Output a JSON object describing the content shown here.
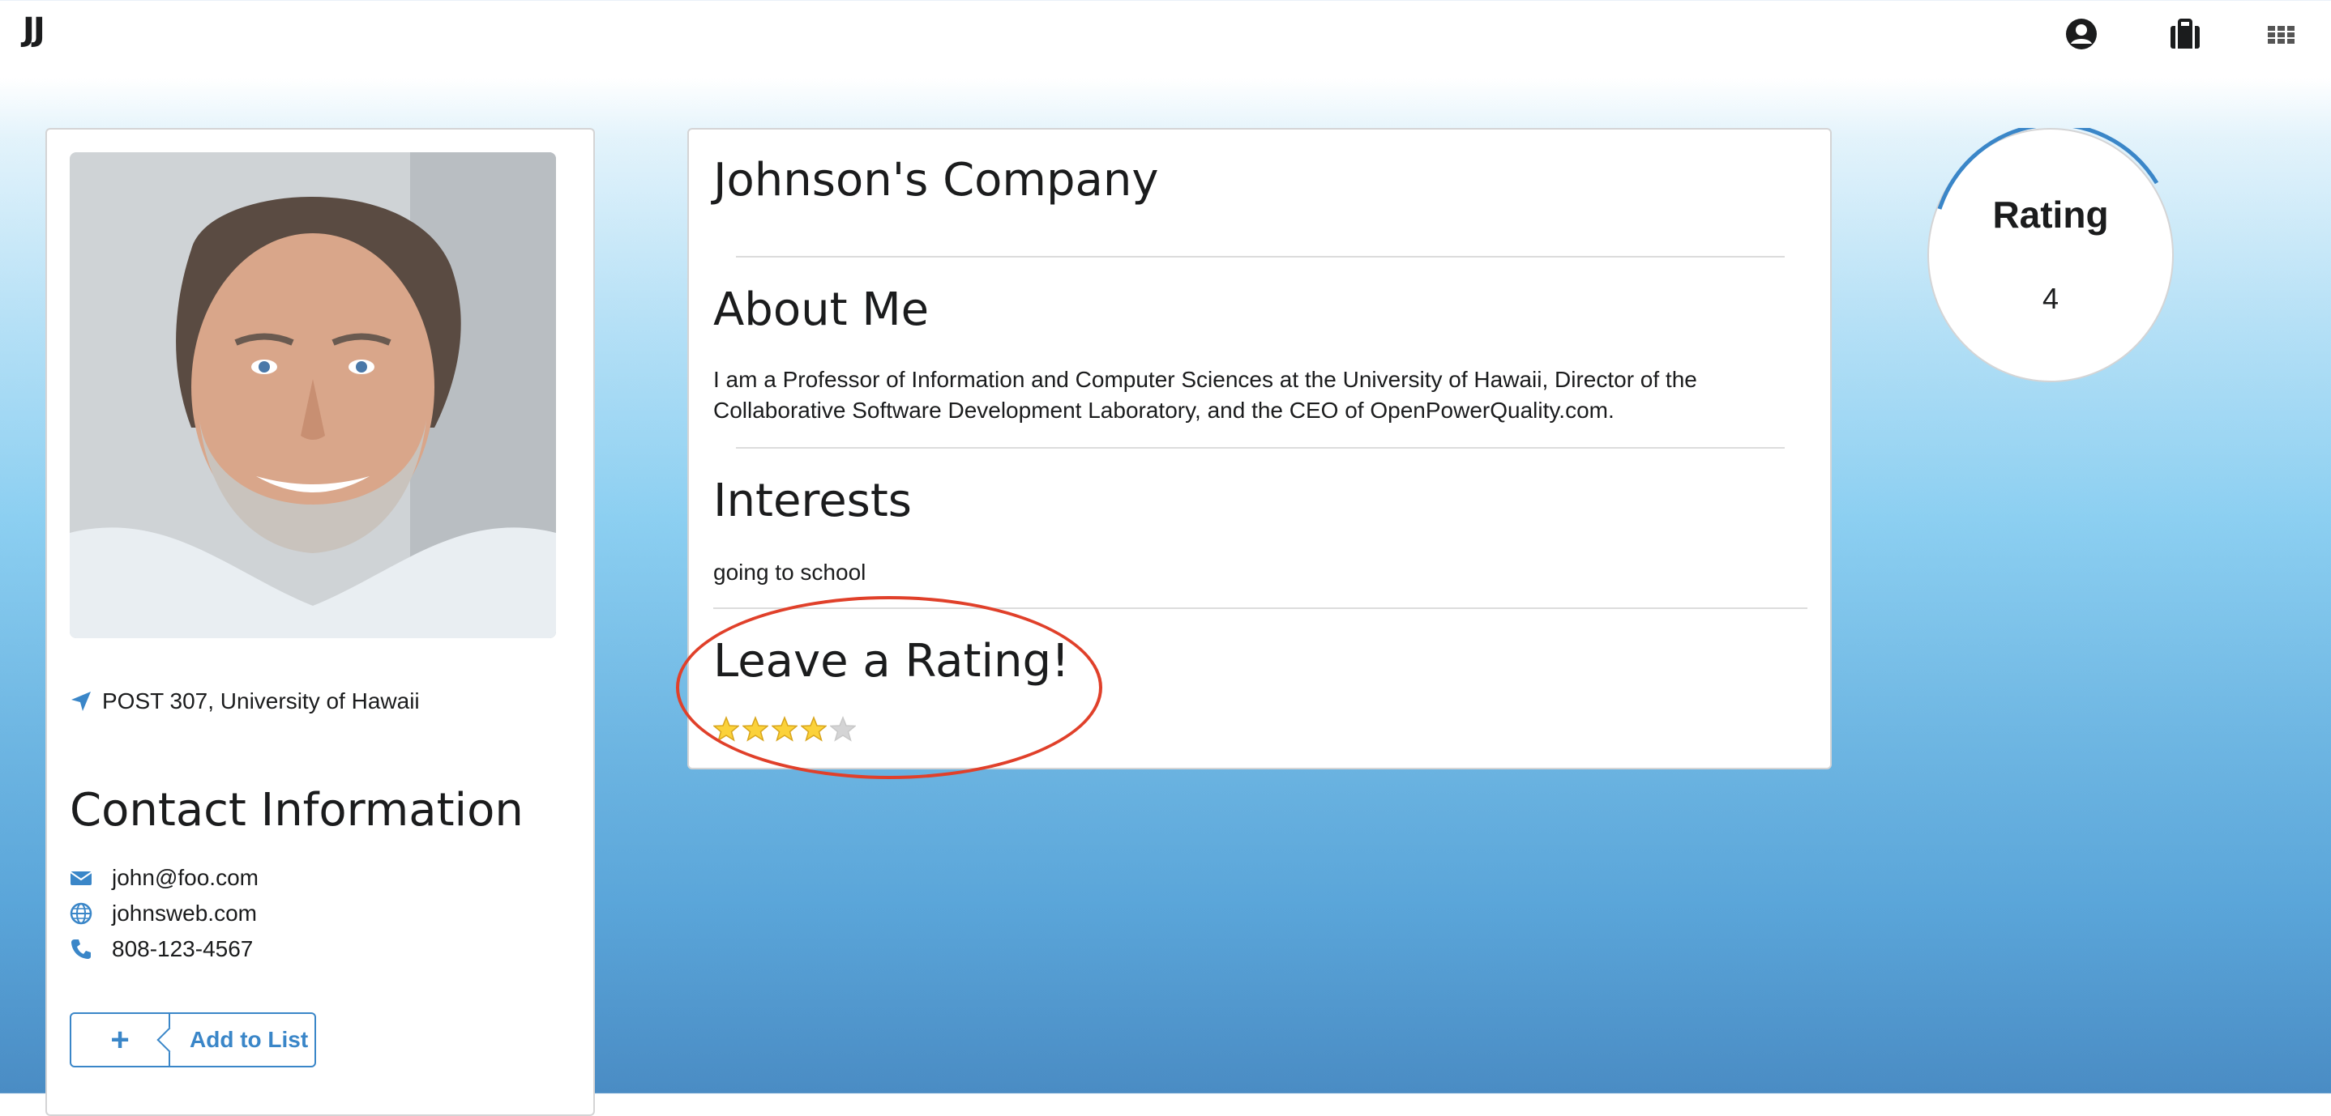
{
  "header": {
    "logo": "JJ",
    "icons": [
      "user-circle-icon",
      "briefcase-icon",
      "grid-icon"
    ]
  },
  "profile": {
    "location": "POST 307, University of Hawaii",
    "contact_title": "Contact Information",
    "email": "john@foo.com",
    "website": "johnsweb.com",
    "phone": "808-123-4567",
    "add_button": {
      "icon": "+",
      "label": "Add to List"
    }
  },
  "main": {
    "company": "Johnson's Company",
    "about_title": "About Me",
    "about_text": "I am a Professor of Information and Computer Sciences at the University of Hawaii, Director of the Collaborative Software Development Laboratory, and the CEO of OpenPowerQuality.com.",
    "about_line1": "I am a Professor of Information and Computer Sciences at the University of Hawaii, Director of the",
    "about_line2": "Collaborative Software Development Laboratory, and the CEO of OpenPowerQuality.com.",
    "interests_title": "Interests",
    "interests_text": "going to school",
    "rating_title": "Leave a Rating!",
    "stars": {
      "filled": 4,
      "total": 5
    }
  },
  "rating": {
    "title": "Rating",
    "value": "4"
  },
  "colors": {
    "accent": "#3a86c8",
    "star": "#fbd23a",
    "star_empty": "#d4d4d5",
    "annotation": "#e0402a"
  }
}
